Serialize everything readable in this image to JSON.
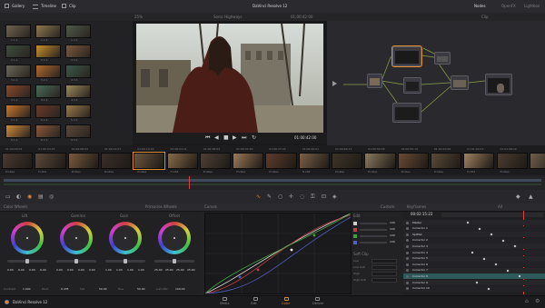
{
  "window": {
    "title": "DaVinci Resolve 12",
    "left_menu": [
      "Gallery",
      "Timeline",
      "Clip"
    ],
    "right_menu": [
      "Nodes",
      "OpenFX",
      "Lightbox"
    ]
  },
  "viewer": {
    "left_label": "Sonic Highways",
    "timecode_top": "01:00:42:00",
    "timecode_bottom": "01:00:42:00",
    "zoom": "25%",
    "mode": "Clip"
  },
  "gallery": {
    "labels": [
      "1.1.1",
      "1.2.1",
      "1.3.1",
      "2.1.1",
      "2.2.1",
      "2.3.1",
      "3.1.1",
      "3.2.1",
      "3.3.1",
      "4.1.1",
      "4.2.1",
      "4.3.1",
      "5.1.1",
      "5.2.1",
      "5.3.1",
      "6.1.1",
      "6.2.1",
      "6.3.1"
    ],
    "colors": [
      "#6e6450",
      "#8d7a52",
      "#4e5a4a",
      "#3e4e3e",
      "#c8902a",
      "#7c5a3c",
      "#6a6a5a",
      "#b06a2a",
      "#3a5a4a",
      "#8a4a2a",
      "#4a6a5a",
      "#9a8a5a",
      "#c8782a",
      "#6a3a2a",
      "#9a7a4a",
      "#d08a3a",
      "#8a5a3a",
      "#5a4a3a"
    ]
  },
  "clips": {
    "timecodes": [
      "01:00:00:03",
      "01:00:03:25",
      "01:00:08:04",
      "01:00:14:07",
      "01:00:19:20",
      "01:00:24:11",
      "01:00:28:02",
      "01:00:33:20",
      "01:00:37:22",
      "01:00:42:01",
      "01:00:46:13",
      "01:00:50:05",
      "01:00:55:14",
      "01:01:00:06",
      "01:01:04:13",
      "01:01:08:22"
    ],
    "codecs": [
      "ProRes",
      "H.264",
      "ProRes",
      "ProRes",
      "ProRes",
      "H.264",
      "ProRes",
      "ProRes",
      "ProRes",
      "H.264",
      "ProRes",
      "ProRes",
      "ProRes",
      "ProRes",
      "H.264",
      "ProRes"
    ],
    "colors": [
      "#4a3a32",
      "#5a4a3a",
      "#7a5a40",
      "#3a2e28",
      "#6a5440",
      "#8a6a4a",
      "#4e4036",
      "#9a7a58",
      "#5e3c2c",
      "#7a6048",
      "#3e3428",
      "#8a7a60",
      "#6a4a34",
      "#5a4a38",
      "#a08060",
      "#4a3c30",
      "#6e5e4a"
    ]
  },
  "color_wheels": {
    "title": "Color Wheels",
    "mode": "Primaries Wheels",
    "wheels": [
      {
        "name": "Lift",
        "values": [
          "0.00",
          "0.00",
          "0.00",
          "0.00"
        ]
      },
      {
        "name": "Gamma",
        "values": [
          "0.00",
          "0.00",
          "0.00",
          "0.00"
        ]
      },
      {
        "name": "Gain",
        "values": [
          "1.00",
          "1.00",
          "1.00",
          "1.00"
        ]
      },
      {
        "name": "Offset",
        "values": [
          "25.00",
          "25.00",
          "25.00",
          "25.00"
        ]
      }
    ],
    "bottom": [
      "Contrast",
      "1.000",
      "Pivot",
      "0.435",
      "Sat",
      "50.00",
      "Hue",
      "50.00",
      "Lum Mix",
      "100.00"
    ]
  },
  "curves": {
    "title": "Curves",
    "panel_title": "Custom",
    "edit_label": "Edit",
    "intensity_values": [
      "100",
      "100",
      "100",
      "100"
    ],
    "soft_clip": {
      "title": "Soft Clip",
      "rows": [
        "Low",
        "Low Soft",
        "High",
        "High Soft"
      ]
    }
  },
  "keyframes": {
    "title": "Keyframes",
    "filter": "All",
    "timecode": "00:02:15:22",
    "rows": [
      "Master",
      "Corrector 1",
      "Splitter",
      "Corrector 2",
      "Corrector 3",
      "Corrector 4",
      "Corrector 5",
      "Corrector 6",
      "Corrector 7",
      "Corrector 8",
      "Corrector 9",
      "Corrector 10"
    ]
  },
  "pages": {
    "items": [
      "Media",
      "Edit",
      "Color",
      "Deliver"
    ],
    "active": "Color"
  },
  "footer": {
    "app_name": "DaVinci Resolve 12"
  },
  "accent": "#e0892f"
}
